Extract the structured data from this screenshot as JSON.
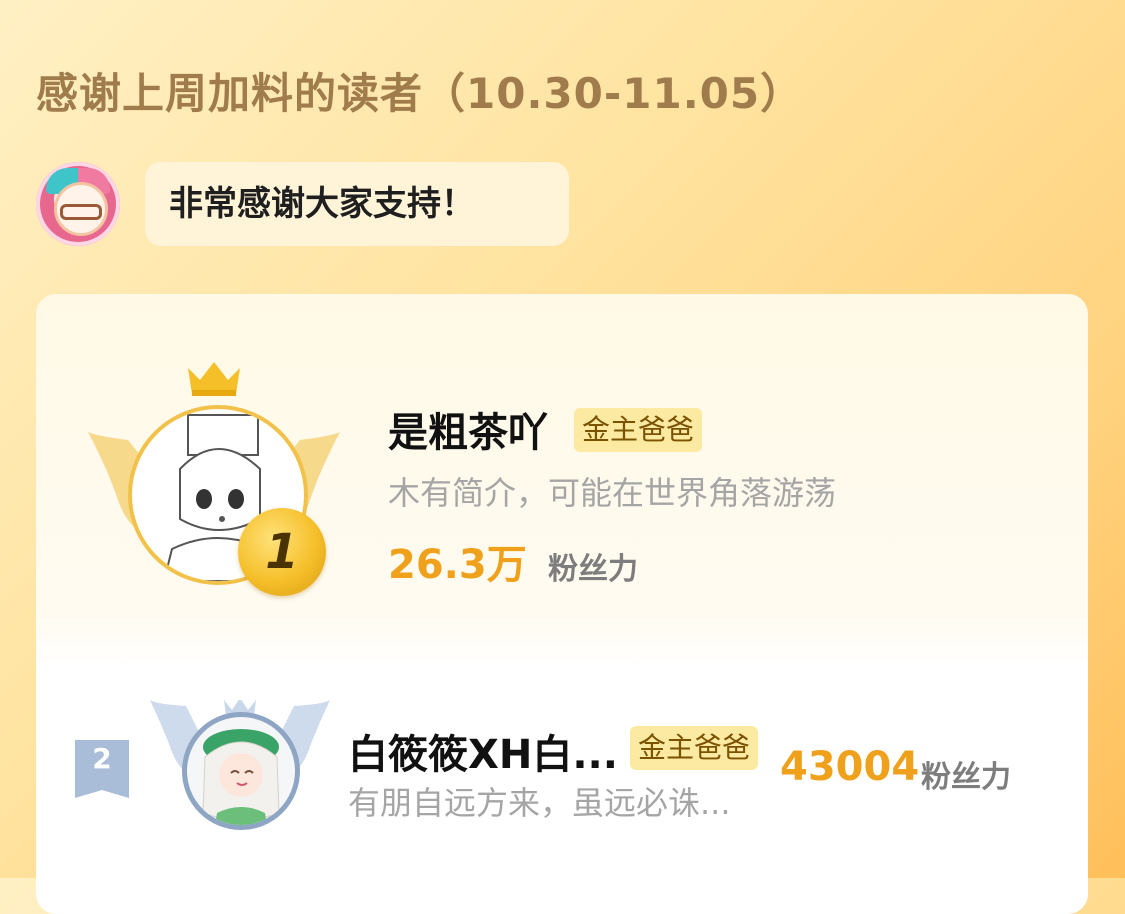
{
  "header": {
    "title": "感谢上周加料的读者（10.30-11.05）",
    "message": "非常感谢大家支持！"
  },
  "ranking": [
    {
      "rank": "1",
      "name": "是粗茶吖",
      "badge": "金主爸爸",
      "bio": "木有简介，可能在世界角落游荡",
      "fan_power": "26.3万",
      "fan_power_label": "粉丝力"
    },
    {
      "rank": "2",
      "name": "白筱筱XH白...",
      "badge": "金主爸爸",
      "bio": "有朋自远方来，虽远必诛...",
      "fan_power": "43004",
      "fan_power_label": "粉丝力"
    }
  ],
  "colors": {
    "accent": "#f0a11c",
    "badge_bg": "#fdeaa2",
    "gold": "#f5bf2a",
    "silver": "#8ea6c4"
  }
}
